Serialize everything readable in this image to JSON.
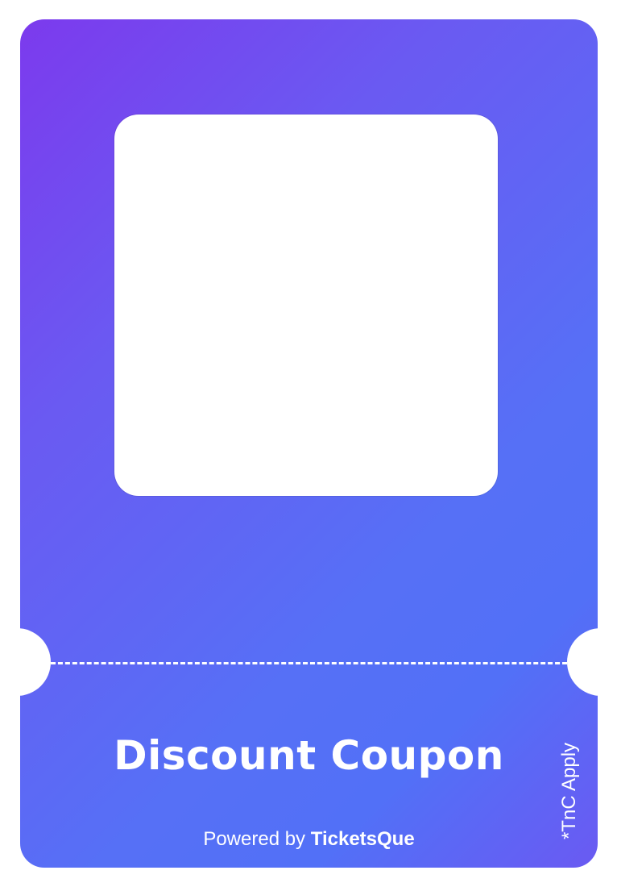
{
  "coupon": {
    "title": "Discount Coupon",
    "terms": "*TnC Apply",
    "powered_prefix": "Powered by",
    "brand": "TicketsQue"
  },
  "colors": {
    "gradient_start": "#7c3aed",
    "gradient_mid": "#5670f6",
    "qr_background": "#ffffff",
    "text": "#ffffff"
  }
}
